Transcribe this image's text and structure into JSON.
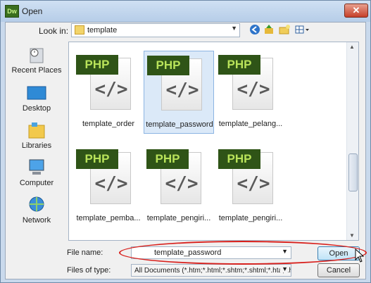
{
  "window": {
    "title": "Open",
    "app_icon_text": "Dw",
    "close_label": "✕"
  },
  "lookin": {
    "label": "Look in:",
    "value": "template"
  },
  "toolbar": {
    "back_icon": "back-icon",
    "up_icon": "up-folder-icon",
    "new_folder_icon": "new-folder-icon",
    "views_icon": "views-menu-icon"
  },
  "places": [
    {
      "label": "Recent Places",
      "icon": "recent-places-icon"
    },
    {
      "label": "Desktop",
      "icon": "desktop-icon"
    },
    {
      "label": "Libraries",
      "icon": "libraries-icon"
    },
    {
      "label": "Computer",
      "icon": "computer-icon"
    },
    {
      "label": "Network",
      "icon": "network-icon"
    }
  ],
  "files": [
    {
      "name": "template_order",
      "badge": "PHP",
      "glyph": "</>",
      "selected": false
    },
    {
      "name": "template_password",
      "badge": "PHP",
      "glyph": "</>",
      "selected": true
    },
    {
      "name": "template_pelang...",
      "badge": "PHP",
      "glyph": "</>",
      "selected": false
    },
    {
      "name": "template_pemba...",
      "badge": "PHP",
      "glyph": "</>",
      "selected": false
    },
    {
      "name": "template_pengiri...",
      "badge": "PHP",
      "glyph": "</>",
      "selected": false
    },
    {
      "name": "template_pengiri...",
      "badge": "PHP",
      "glyph": "</>",
      "selected": false
    }
  ],
  "form": {
    "filename_label": "File name:",
    "filename_value": "template_password",
    "filetype_label": "Files of type:",
    "filetype_value": "All Documents (*.htm;*.html;*.shtm;*.shtml;*.hta;*.htc;*.xhtml;*.stm;*.ssi;*.js;*.json;*.as;*.asc;*.asr;*.xml;*.xsl;*.xsd;*.dtd;*.xslt;*.rss;*.rdf;*.lbi;*.dwt;*.asp;*.asa;*.aspx;*.ascx;*.asmx;*.config;*.cs;*.css;*.cfm;*.cfml;*.cfc;*.tpl;*.php)"
  },
  "buttons": {
    "open": "Open",
    "cancel": "Cancel"
  },
  "colors": {
    "highlight_ellipse": "#d8201c",
    "php_badge": "#2f5417"
  }
}
